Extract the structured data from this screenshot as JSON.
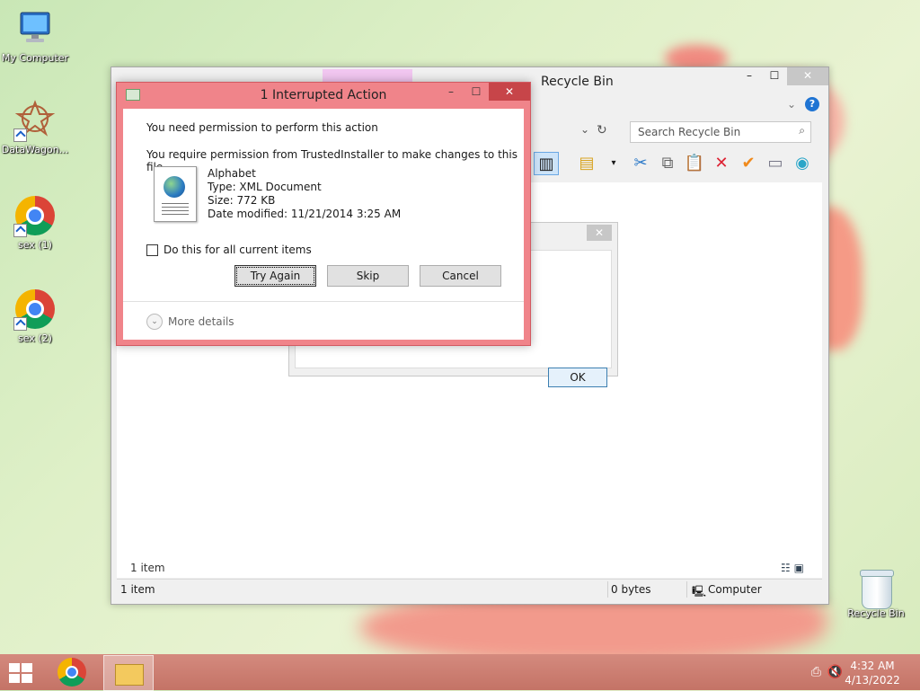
{
  "desktop": {
    "icons": [
      {
        "label": "My Computer"
      },
      {
        "label": "DataWagon..."
      },
      {
        "label": "sex (1)"
      },
      {
        "label": "sex (2)"
      },
      {
        "label": "Recycle Bin"
      }
    ]
  },
  "explorer": {
    "title": "Recycle Bin",
    "search_placeholder": "Search Recycle Bin",
    "content_status": "1 item",
    "statusbar": {
      "items": "1 item",
      "size": "0 bytes",
      "location": "Computer"
    }
  },
  "bg_dialog": {
    "ok_label": "OK"
  },
  "dialog": {
    "title": "1 Interrupted Action",
    "message": "You need permission to perform this action",
    "detail": "You require permission from TrustedInstaller to make changes to this file",
    "file": {
      "name": "Alphabet",
      "type": "Type: XML Document",
      "size": "Size: 772 KB",
      "modified": "Date modified: 11/21/2014 3:25 AM"
    },
    "checkbox_label": "Do this for all current items",
    "buttons": {
      "try_again": "Try Again",
      "skip": "Skip",
      "cancel": "Cancel"
    },
    "more_details": "More details"
  },
  "taskbar": {
    "time": "4:32 AM",
    "date": "4/13/2022"
  },
  "colors": {
    "dialog_frame": "#f0848a",
    "taskbar": "#c47366",
    "accent_blue": "#1f74d3"
  }
}
